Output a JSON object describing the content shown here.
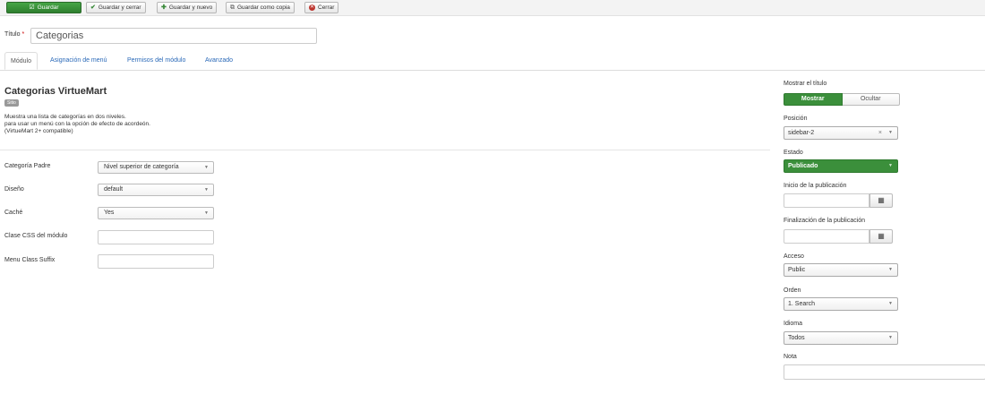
{
  "toolbar": {
    "save": "Guardar",
    "save_close": "Guardar y cerrar",
    "save_new": "Guardar y nuevo",
    "save_copy": "Guardar como copia",
    "close": "Cerrar"
  },
  "title": {
    "label": "Título",
    "required": "*",
    "value": "Categorias"
  },
  "tabs": [
    "Módulo",
    "Asignación de menú",
    "Permisos del módulo",
    "Avanzado"
  ],
  "module": {
    "name": "Categorias VirtueMart",
    "badge": "Sitio",
    "description": [
      "Muestra una lista de categorías en dos niveles.",
      "para usar un menú con la opción de efecto de acordeón.",
      "(VirtueMart 2+ compatible)"
    ]
  },
  "fields": {
    "parent_category": {
      "label": "Categoría Padre",
      "value": "Nivel superior de categoría"
    },
    "layout": {
      "label": "Diseño",
      "value": "default"
    },
    "cache": {
      "label": "Caché",
      "value": "Yes"
    },
    "css_class": {
      "label": "Clase CSS del módulo",
      "value": ""
    },
    "menu_class_suffix": {
      "label": "Menu Class Suffix",
      "value": ""
    }
  },
  "sidebar": {
    "show_title": {
      "label": "Mostrar el título",
      "on": "Mostrar",
      "off": "Ocultar"
    },
    "position": {
      "label": "Posición",
      "value": "sidebar-2"
    },
    "status": {
      "label": "Estado",
      "value": "Publicado"
    },
    "publish_start": {
      "label": "Inicio de la publicación",
      "value": ""
    },
    "publish_end": {
      "label": "Finalización de la publicación",
      "value": ""
    },
    "access": {
      "label": "Acceso",
      "value": "Public"
    },
    "ordering": {
      "label": "Orden",
      "value": "1. Search"
    },
    "language": {
      "label": "Idioma",
      "value": "Todos"
    },
    "note": {
      "label": "Nota",
      "value": ""
    }
  },
  "colors": {
    "primary_green": "#3b8f3b",
    "link_blue": "#2a69b8"
  }
}
